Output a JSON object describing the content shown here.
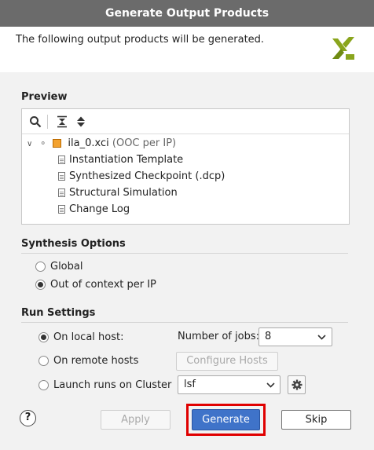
{
  "window": {
    "title": "Generate Output Products"
  },
  "banner": {
    "message": "The following output products will be generated."
  },
  "preview": {
    "label": "Preview",
    "toolbar": [
      {
        "name": "search-icon"
      },
      {
        "name": "collapse-all-icon"
      },
      {
        "name": "expand-all-icon"
      }
    ],
    "tree": {
      "root": {
        "name": "ila_0.xci",
        "suffix": "(OOC per IP)"
      },
      "children": [
        "Instantiation Template",
        "Synthesized Checkpoint (.dcp)",
        "Structural Simulation",
        "Change Log"
      ]
    }
  },
  "synthesis_options": {
    "label": "Synthesis Options",
    "options": [
      {
        "label": "Global",
        "selected": false
      },
      {
        "label": "Out of context per IP",
        "selected": true
      }
    ]
  },
  "run_settings": {
    "label": "Run Settings",
    "on_local_host": "On local host:",
    "on_remote_hosts": "On remote hosts",
    "launch_on_cluster": "Launch runs on Cluster",
    "selected": "local",
    "jobs_label": "Number of jobs:",
    "jobs_value": "8",
    "configure_hosts": "Configure Hosts",
    "cluster_value": "lsf"
  },
  "footer": {
    "help": "?",
    "apply": "Apply",
    "generate": "Generate",
    "skip": "Skip"
  },
  "colors": {
    "titlebar": "#6b6b6b",
    "generate_button": "#3f73c9",
    "highlight_box": "#e00000",
    "logo_green": "#8aa51d"
  }
}
